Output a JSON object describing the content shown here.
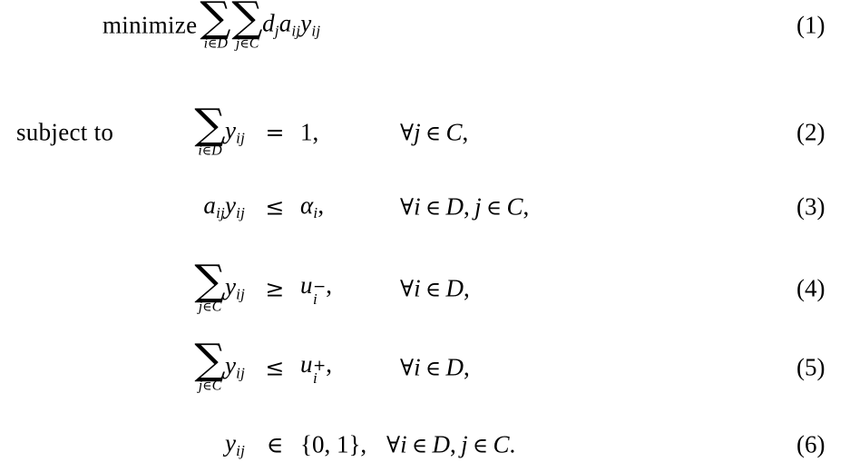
{
  "document": {
    "type": "mathematical-optimization-model",
    "background_color": "#ffffff",
    "text_color": "#000000"
  },
  "objective": {
    "keyword": "minimize",
    "sum_outer": {
      "symbol": "∑",
      "index": "i",
      "setop": "∈",
      "set": "D"
    },
    "sum_inner": {
      "symbol": "∑",
      "index": "j",
      "setop": "∈",
      "set": "C"
    },
    "term_d": "d",
    "term_d_sub": "j",
    "term_a": "a",
    "term_a_sub": "ij",
    "term_y": "y",
    "term_y_sub": "ij",
    "number": "(1)"
  },
  "subject_to_label": "subject to",
  "constraints": [
    {
      "id": "c2",
      "lhs_kind": "sum",
      "sum": {
        "symbol": "∑",
        "index": "i",
        "setop": "∈",
        "set": "D"
      },
      "lhs_var": "y",
      "lhs_var_sub": "ij",
      "relation": "=",
      "rhs": "1,",
      "quantifier": "∀j ∈ C,",
      "quant_forall": "∀",
      "quant_index": "j",
      "quant_setop": "∈",
      "quant_set": "C",
      "quant_punc": ",",
      "number": "(2)"
    },
    {
      "id": "c3",
      "lhs_kind": "product",
      "lhs_a": "a",
      "lhs_a_sub": "ij",
      "lhs_var": "y",
      "lhs_var_sub": "ij",
      "relation": "≤",
      "rhs_symbol": "α",
      "rhs_sub": "i",
      "rhs_punc": ",",
      "quantifier": "∀i ∈ D, j ∈ C,",
      "quant_forall": "∀",
      "quant_index": "i",
      "quant_setop": "∈",
      "quant_set": "D",
      "quant_index2": "j",
      "quant_set2": "C",
      "quant_punc": ",",
      "number": "(3)"
    },
    {
      "id": "c4",
      "lhs_kind": "sum",
      "sum": {
        "symbol": "∑",
        "index": "j",
        "setop": "∈",
        "set": "C"
      },
      "lhs_var": "y",
      "lhs_var_sub": "ij",
      "relation": "≥",
      "rhs_symbol": "u",
      "rhs_sub": "i",
      "rhs_sup": "−",
      "rhs_punc": ",",
      "quantifier": "∀i ∈ D,",
      "quant_forall": "∀",
      "quant_index": "i",
      "quant_setop": "∈",
      "quant_set": "D",
      "quant_punc": ",",
      "number": "(4)"
    },
    {
      "id": "c5",
      "lhs_kind": "sum",
      "sum": {
        "symbol": "∑",
        "index": "j",
        "setop": "∈",
        "set": "C"
      },
      "lhs_var": "y",
      "lhs_var_sub": "ij",
      "relation": "≤",
      "rhs_symbol": "u",
      "rhs_sub": "i",
      "rhs_sup": "+",
      "rhs_punc": ",",
      "quantifier": "∀i ∈ D,",
      "quant_forall": "∀",
      "quant_index": "i",
      "quant_setop": "∈",
      "quant_set": "D",
      "quant_punc": ",",
      "number": "(5)"
    },
    {
      "id": "c6",
      "lhs_kind": "var",
      "lhs_var": "y",
      "lhs_var_sub": "ij",
      "relation": "∈",
      "rhs": "{0, 1},",
      "quantifier": "∀i ∈ D, j ∈ C.",
      "quant_forall": "∀",
      "quant_index": "i",
      "quant_setop": "∈",
      "quant_set": "D",
      "quant_index2": "j",
      "quant_set2": "C",
      "quant_punc": ".",
      "number": "(6)"
    }
  ]
}
